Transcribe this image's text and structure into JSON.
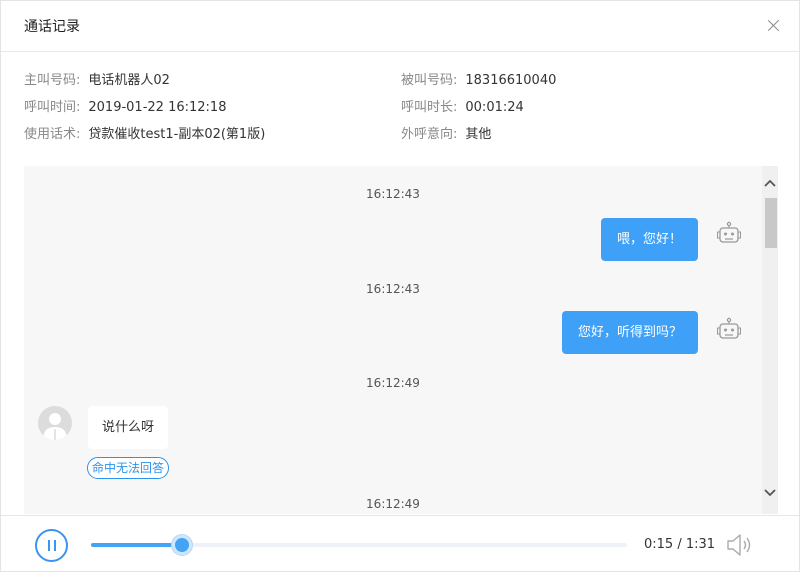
{
  "dialog": {
    "title": "通话记录"
  },
  "info": {
    "caller_label": "主叫号码:",
    "caller_value": "电话机器人02",
    "callee_label": "被叫号码:",
    "callee_value": "18316610040",
    "call_time_label": "呼叫时间:",
    "call_time_value": "2019-01-22 16:12:18",
    "duration_label": "呼叫时长:",
    "duration_value": "00:01:24",
    "script_label": "使用话术:",
    "script_value": "贷款催收test1-副本02(第1版)",
    "intent_label": "外呼意向:",
    "intent_value": "其他"
  },
  "messages": [
    {
      "time": "16:12:43",
      "side": "robot",
      "text": "喂，您好！",
      "icon": "robot-icon"
    },
    {
      "time": "16:12:43",
      "side": "robot",
      "text": "您好，听得到吗？",
      "icon": "robot-icon"
    },
    {
      "time": "16:12:49",
      "side": "user",
      "text": "说什么呀",
      "icon": "user-avatar-icon",
      "tag": "命中无法回答"
    },
    {
      "time": "16:12:49"
    }
  ],
  "player": {
    "time": "0:15 / 1:31",
    "progress": 0.17,
    "state": "playing",
    "play_icon": "pause-icon",
    "volume_icon": "volume-icon"
  },
  "colors": {
    "accent": "#3ea1f7",
    "bubble_user": "#ffffff",
    "chat_bg": "#f7f7f7"
  }
}
